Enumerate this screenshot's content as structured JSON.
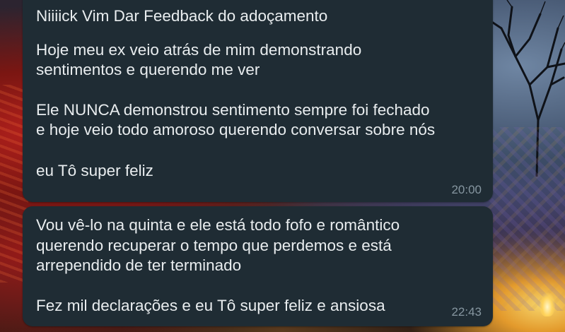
{
  "chat": {
    "messages": [
      {
        "lines": [
          "Niiiick Vim Dar Feedback do adoçamento",
          "Hoje meu ex veio atrás de mim demonstrando",
          "sentimentos e querendo me ver",
          "Ele NUNCA demonstrou sentimento sempre foi fechado",
          "e hoje veio todo amoroso querendo conversar sobre nós",
          "eu Tô super feliz"
        ],
        "time": "20:00"
      },
      {
        "lines": [
          "Vou vê-lo na quinta e ele está todo fofo e romântico",
          "querendo recuperar o tempo que perdemos e está",
          "arrependido de ter terminado",
          "Fez mil declarações e eu Tô super feliz e ansiosa"
        ],
        "time": "22:43"
      }
    ]
  },
  "wallpaper": {
    "description_icons": [
      "tree-icon",
      "candle-icon"
    ],
    "colors": {
      "bubble_bg": "#1f2c34",
      "text": "#e9edef",
      "timestamp": "#8696a0"
    }
  }
}
